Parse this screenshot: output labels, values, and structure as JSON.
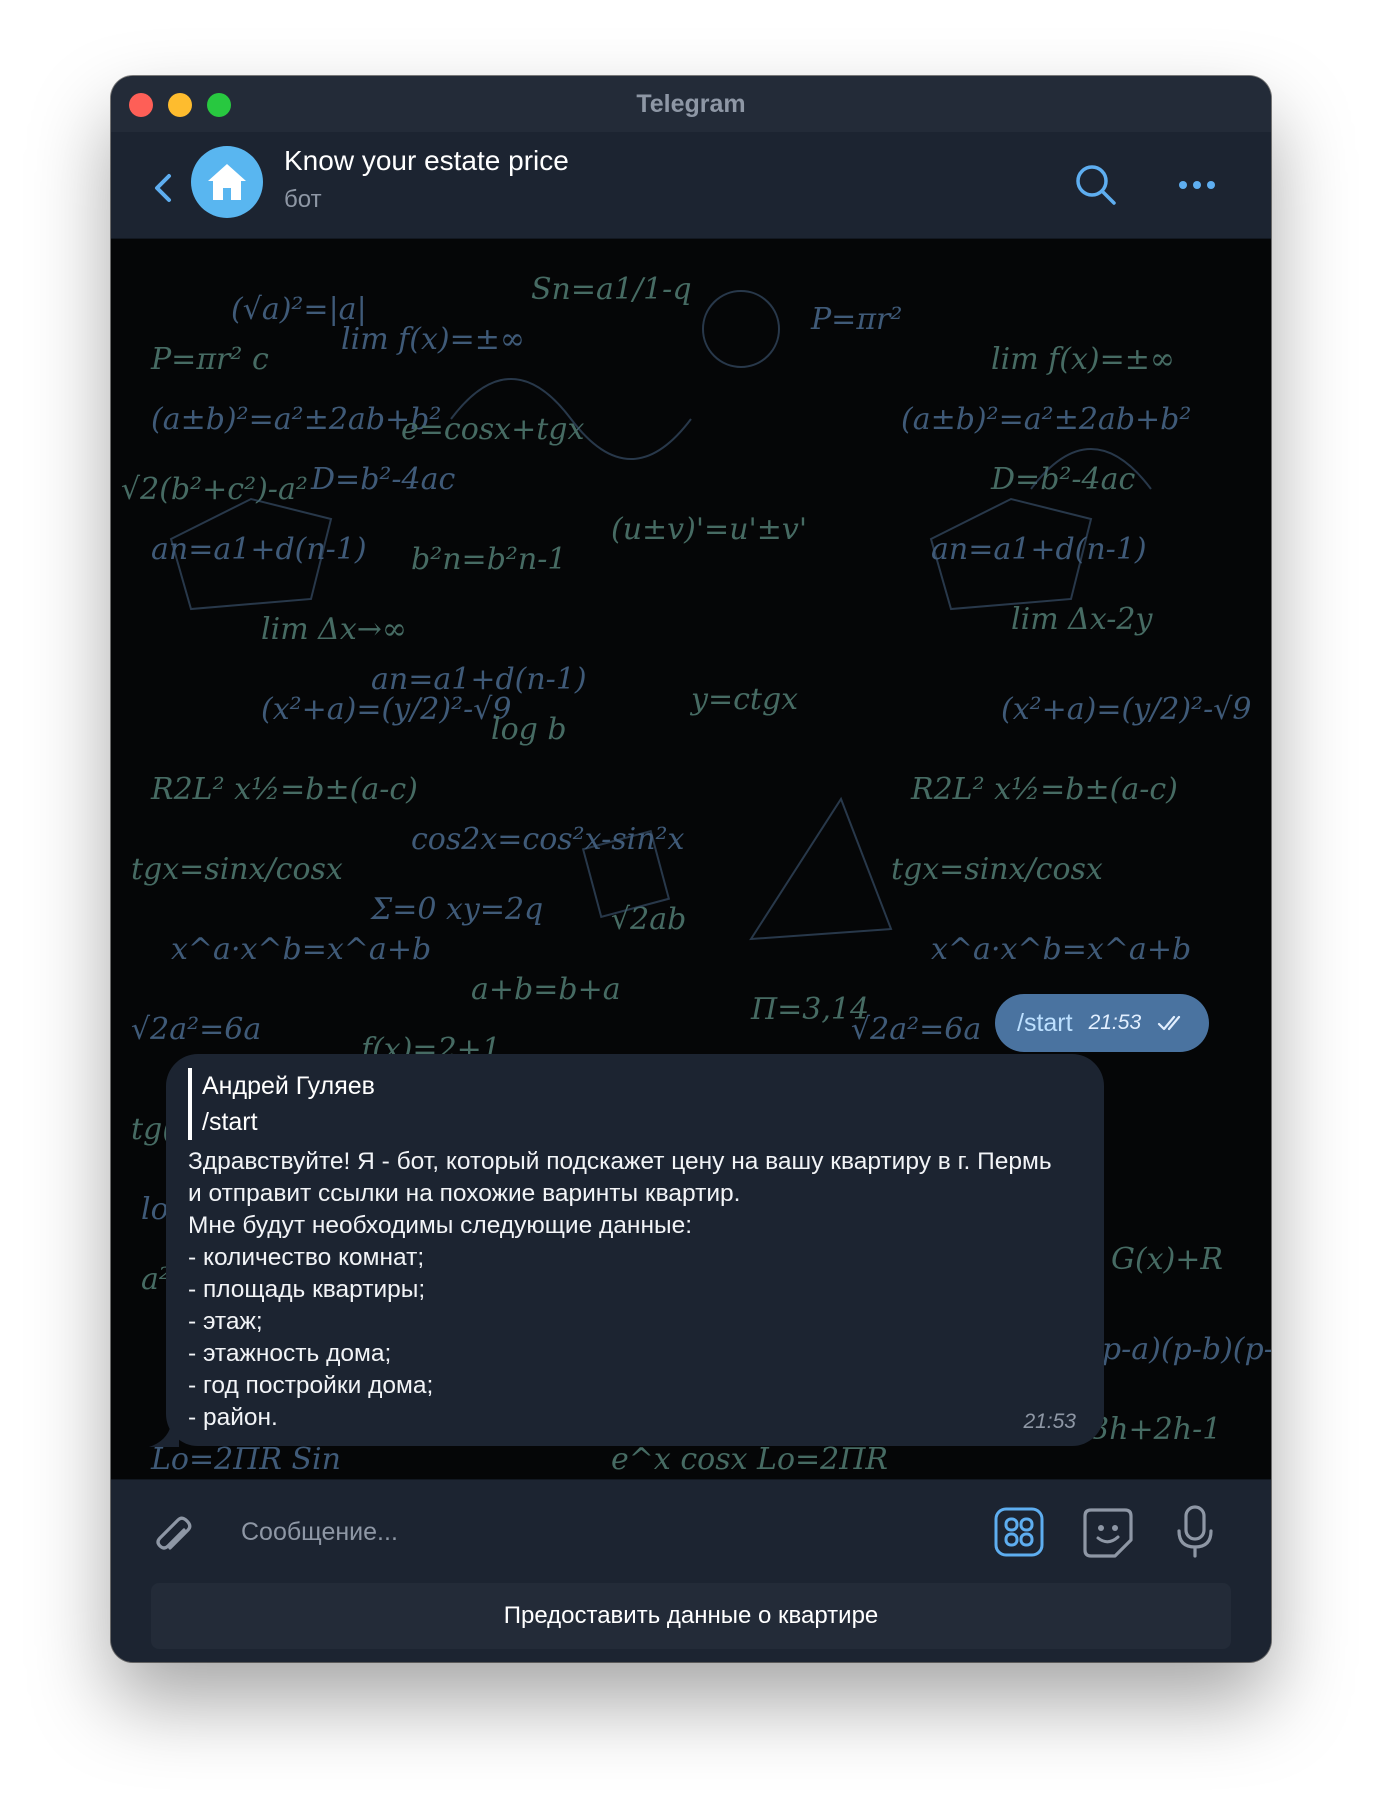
{
  "window": {
    "title": "Telegram"
  },
  "header": {
    "chat_name": "Know your estate price",
    "chat_status": "бот"
  },
  "messages": {
    "outgoing": {
      "text": "/start",
      "time": "21:53"
    },
    "incoming": {
      "reply_author": "Андрей Гуляев",
      "reply_text": "/start",
      "text": "Здравствуйте! Я - бот, который подскажет цену на вашу квартиру в г. Пермь и отправит ссылки на похожие варинты квартир.\nМне будут необходимы следующие данные:\n- количество комнат;\n- площадь квартиры;\n- этаж;\n- этажность дома;\n- год постройки дома;\n- район.",
      "time": "21:53"
    }
  },
  "composer": {
    "placeholder": "Сообщение...",
    "keyboard_button": "Предоставить данные о квартире"
  },
  "colors": {
    "accent": "#5eaef0",
    "outgoing_bubble": "#4a73a0",
    "incoming_bubble": "#1c2431",
    "avatar": "#59b6f0"
  }
}
